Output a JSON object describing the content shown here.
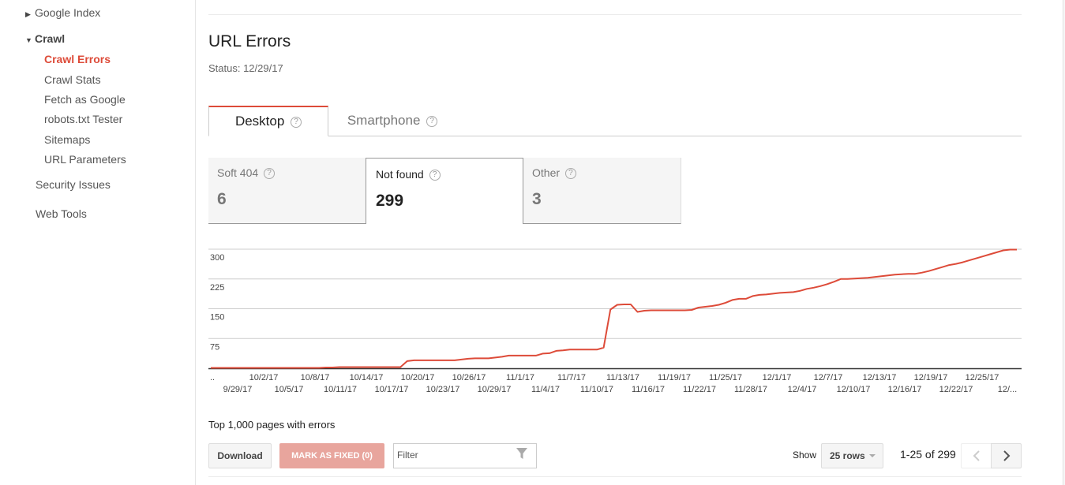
{
  "sidebar": {
    "google_index": "Google Index",
    "crawl": "Crawl",
    "crawl_children": [
      "Crawl Errors",
      "Crawl Stats",
      "Fetch as Google",
      "robots.txt Tester",
      "Sitemaps",
      "URL Parameters"
    ],
    "security_issues": "Security Issues",
    "web_tools": "Web Tools",
    "active_item": "Crawl Errors"
  },
  "header": {
    "title": "URL Errors",
    "status": "Status: 12/29/17"
  },
  "tabs": [
    {
      "label": "Desktop",
      "selected": true,
      "icon": "help-icon"
    },
    {
      "label": "Smartphone",
      "selected": false,
      "icon": "help-icon"
    }
  ],
  "cards": [
    {
      "label": "Soft 404",
      "value": "6",
      "selected": false
    },
    {
      "label": "Not found",
      "value": "299",
      "selected": true
    },
    {
      "label": "Other",
      "value": "3",
      "selected": false
    }
  ],
  "colors": {
    "accent": "#dd4b39",
    "line": "#dd4b39",
    "mark_fixed_disabled": "#e8a59d"
  },
  "chart_data": {
    "type": "line",
    "title": "",
    "xlabel": "",
    "ylabel": "",
    "ylim": [
      0,
      300
    ],
    "yticks": [
      75,
      150,
      225,
      300
    ],
    "grid": true,
    "legend": "none",
    "x_tick_row1": [
      "10/2/17",
      "10/8/17",
      "10/14/17",
      "10/20/17",
      "10/26/17",
      "11/1/17",
      "11/7/17",
      "11/13/17",
      "11/19/17",
      "11/25/17",
      "12/1/17",
      "12/7/17",
      "12/13/17",
      "12/19/17",
      "12/25/17"
    ],
    "x_tick_row2": [
      "..",
      "9/29/17",
      "10/5/17",
      "10/11/17",
      "10/17/17",
      "10/23/17",
      "10/29/17",
      "11/4/17",
      "11/10/17",
      "11/16/17",
      "11/22/17",
      "11/28/17",
      "12/4/17",
      "12/10/17",
      "12/16/17",
      "12/22/17",
      "12/..."
    ],
    "series": [
      {
        "name": "Not found",
        "start_date": "9/26/17",
        "values": [
          1,
          1,
          1,
          1,
          1,
          1,
          1,
          1,
          1,
          1,
          1,
          1,
          1,
          1,
          1,
          1,
          1,
          2,
          2,
          3,
          3,
          3,
          3,
          3,
          3,
          3,
          3,
          3,
          3,
          18,
          20,
          20,
          20,
          20,
          20,
          20,
          20,
          22,
          24,
          25,
          25,
          25,
          27,
          29,
          32,
          32,
          32,
          32,
          32,
          37,
          38,
          44,
          45,
          47,
          47,
          47,
          47,
          47,
          52,
          148,
          160,
          161,
          161,
          142,
          145,
          146,
          146,
          146,
          146,
          146,
          146,
          147,
          153,
          155,
          157,
          160,
          165,
          172,
          175,
          175,
          182,
          185,
          186,
          188,
          190,
          191,
          192,
          195,
          200,
          203,
          207,
          212,
          218,
          225,
          225,
          226,
          227,
          228,
          230,
          232,
          234,
          236,
          237,
          238,
          238,
          241,
          245,
          250,
          255,
          260,
          263,
          267,
          272,
          277,
          282,
          287,
          292,
          297,
          299,
          299
        ]
      }
    ]
  },
  "table": {
    "title": "Top 1,000 pages with errors",
    "download_label": "Download",
    "mark_fixed_label": "MARK AS FIXED (0)",
    "filter_placeholder": "Filter",
    "filter_value": "",
    "show_label": "Show",
    "rows_option": "25 rows",
    "pager_text": "1-25 of 299"
  }
}
